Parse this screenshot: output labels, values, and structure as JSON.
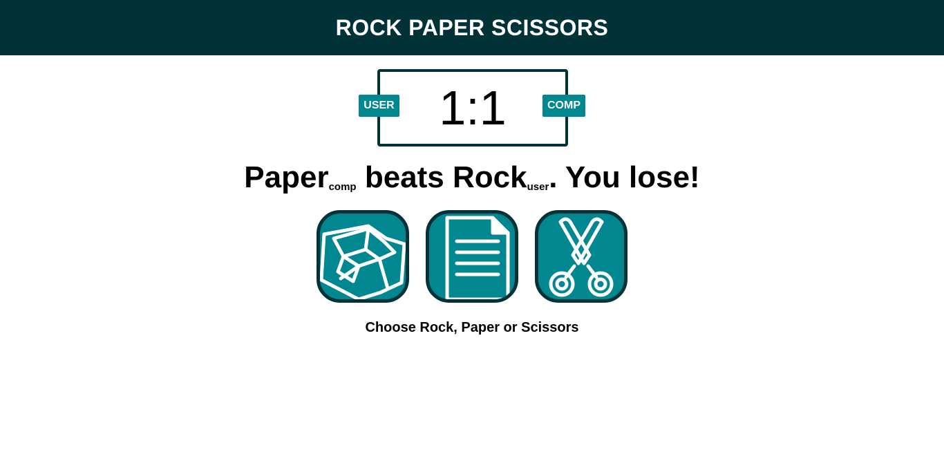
{
  "header": {
    "title": "ROCK PAPER SCISSORS"
  },
  "scoreboard": {
    "user_label": "USER",
    "comp_label": "COMP",
    "score": "1:1"
  },
  "result": {
    "comp_choice": "Paper",
    "comp_tag": "comp",
    "verb": " beats ",
    "user_choice": "Rock",
    "user_tag": "user",
    "outcome": ". You lose!"
  },
  "choices": [
    {
      "label": "Rock",
      "icon": "rock-icon"
    },
    {
      "label": "Paper",
      "icon": "paper-icon"
    },
    {
      "label": "Scissors",
      "icon": "scissors-icon"
    }
  ],
  "prompt": "Choose Rock, Paper or Scissors",
  "colors": {
    "header_bg": "#003237",
    "accent": "#00878f",
    "border": "#003237"
  }
}
